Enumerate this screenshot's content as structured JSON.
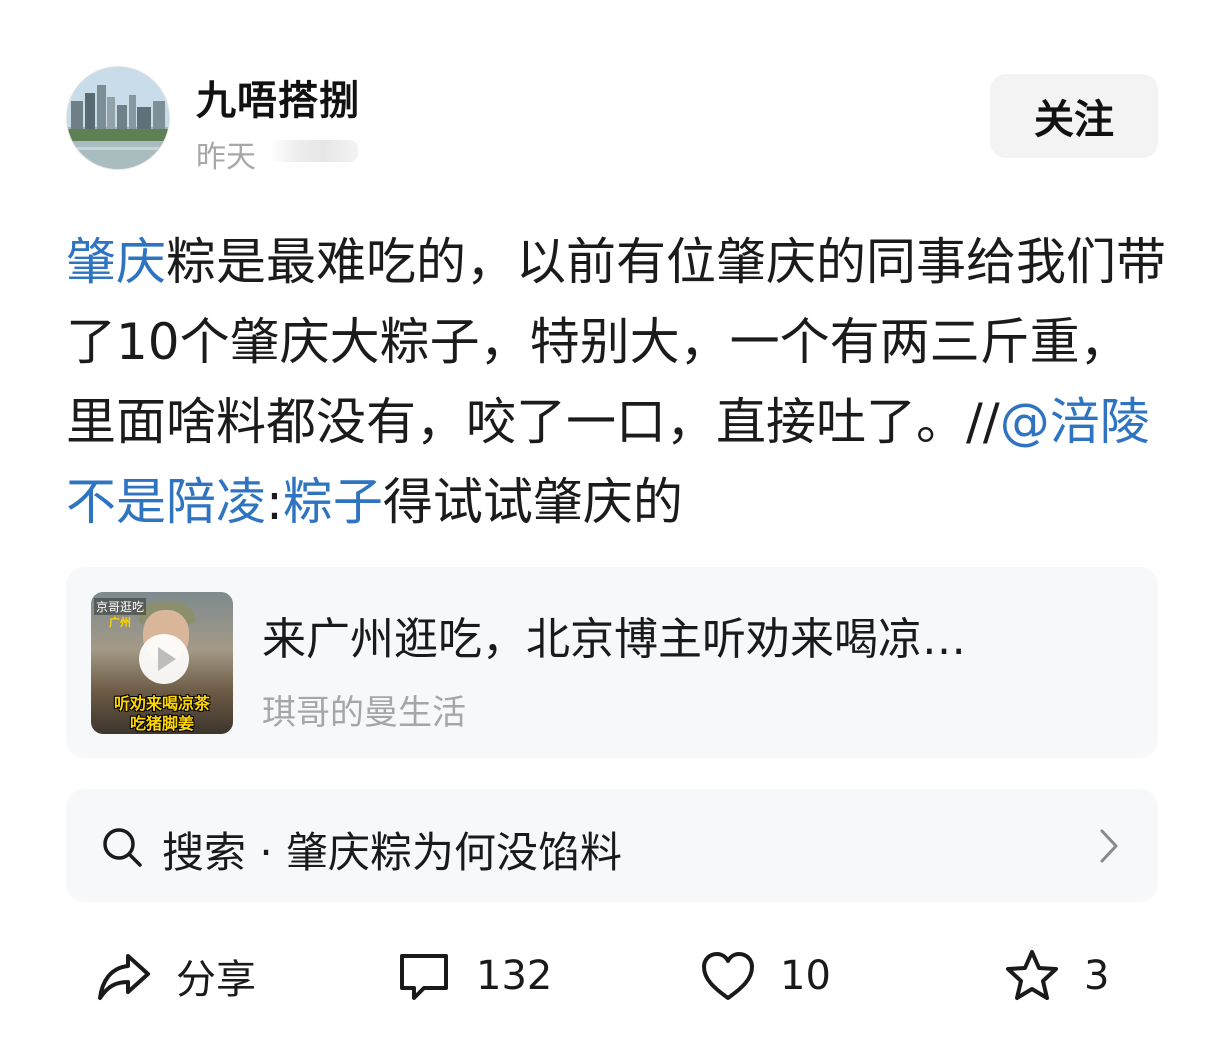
{
  "author": {
    "name": "九唔搭捌",
    "time": "昨天",
    "follow_label": "关注"
  },
  "post": {
    "segments": [
      {
        "text": "肇庆",
        "link": true
      },
      {
        "text": "粽是最难吃的，以前有位肇庆的同事给我们带了10个肇庆大粽子，特别大，一个有两三斤重，里面啥料都没有，咬了一口，直接吐了。//",
        "link": false
      },
      {
        "text": "@涪陵不是陪凌",
        "link": true
      },
      {
        "text": ":",
        "link": false
      },
      {
        "text": "粽子",
        "link": true
      },
      {
        "text": "得试试肇庆的",
        "link": false
      }
    ],
    "link_color": "#2f74c0"
  },
  "video_card": {
    "title": "来广州逛吃，北京博主听劝来喝凉…",
    "author": "琪哥的曼生活",
    "thumb_tag": "京哥逛吃",
    "thumb_city": "广州",
    "thumb_caption_1": "听劝来喝凉茶",
    "thumb_caption_2": "吃猪脚姜",
    "icon": "play-icon"
  },
  "search": {
    "label": "搜索 · 肇庆粽为何没馅料",
    "icon": "search-icon"
  },
  "actions": {
    "share": {
      "label": "分享",
      "icon": "share-icon"
    },
    "comment": {
      "count": "132",
      "icon": "comment-icon"
    },
    "like": {
      "count": "10",
      "icon": "heart-icon"
    },
    "favorite": {
      "count": "3",
      "icon": "star-icon"
    }
  }
}
